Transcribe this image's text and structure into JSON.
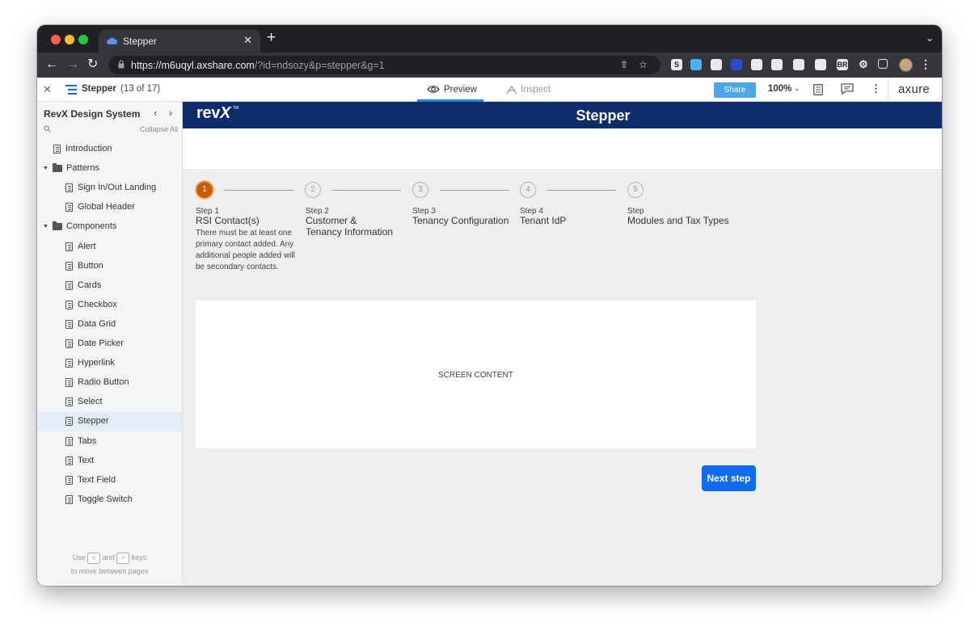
{
  "browser": {
    "tab_title": "Stepper",
    "tab_close": "✕",
    "new_tab": "+",
    "url_host": "https://m6uqyl.axshare.com",
    "url_path": "/?id=ndsozy&p=stepper&g=1",
    "extensions": [
      {
        "label": "S",
        "color": "#e8eaed"
      },
      {
        "label": "",
        "color": "#4db0ff"
      },
      {
        "label": "",
        "color": "#e8eaed"
      },
      {
        "label": "",
        "color": "#2b4bd1"
      },
      {
        "label": "",
        "color": "#e8eaed"
      },
      {
        "label": "",
        "color": "#e8eaed"
      },
      {
        "label": "",
        "color": "#e8eaed"
      },
      {
        "label": "",
        "color": "#e8eaed"
      },
      {
        "label": "BR",
        "color": "#e8eaed"
      }
    ]
  },
  "axure_toolbar": {
    "page_name": "Stepper",
    "page_count": "(13 of 17)",
    "preview_label": "Preview",
    "inspect_label": "Inspect",
    "share_label": "Share",
    "zoom": "100%",
    "logo": "axure"
  },
  "sidebar": {
    "title": "RevX Design System",
    "collapse_all": "Collapse All",
    "items": [
      {
        "label": "Introduction",
        "type": "page",
        "level": 0
      },
      {
        "label": "Patterns",
        "type": "folder",
        "level": 0
      },
      {
        "label": "Sign In/Out Landing",
        "type": "page",
        "level": 1
      },
      {
        "label": "Global Header",
        "type": "page",
        "level": 1
      },
      {
        "label": "Components",
        "type": "folder",
        "level": 0
      },
      {
        "label": "Alert",
        "type": "page",
        "level": 1
      },
      {
        "label": "Button",
        "type": "page",
        "level": 1
      },
      {
        "label": "Cards",
        "type": "page",
        "level": 1
      },
      {
        "label": "Checkbox",
        "type": "page",
        "level": 1
      },
      {
        "label": "Data Grid",
        "type": "page",
        "level": 1
      },
      {
        "label": "Date Picker",
        "type": "page",
        "level": 1
      },
      {
        "label": "Hyperlink",
        "type": "page",
        "level": 1
      },
      {
        "label": "Radio Button",
        "type": "page",
        "level": 1
      },
      {
        "label": "Select",
        "type": "page",
        "level": 1
      },
      {
        "label": "Stepper",
        "type": "page",
        "level": 1,
        "active": true
      },
      {
        "label": "Tabs",
        "type": "page",
        "level": 1
      },
      {
        "label": "Text",
        "type": "page",
        "level": 1
      },
      {
        "label": "Text Field",
        "type": "page",
        "level": 1
      },
      {
        "label": "Toggle Switch",
        "type": "page",
        "level": 1
      }
    ],
    "hint_use": "Use",
    "hint_and": "and",
    "hint_keys": "keys",
    "hint_line2": "to move between pages",
    "key_prev": "<",
    "key_next": ">"
  },
  "app": {
    "brand": "rev",
    "brand_x": "X",
    "brand_tm": "TM",
    "header_title": "Stepper",
    "brand_color": "#0d2c6c",
    "accent_color": "#c85c0a",
    "button_color": "#0f6cf0"
  },
  "stepper": {
    "steps": [
      {
        "number": "1",
        "step_label": "Step 1",
        "title": "RSI Contact(s)",
        "description": "There must be at least one primary contact added. Any additional people added will be secondary contacts.",
        "active": true
      },
      {
        "number": "2",
        "step_label": "Step 2",
        "title": "Customer &\nTenancy Information",
        "description": "",
        "active": false
      },
      {
        "number": "3",
        "step_label": "Step 3",
        "title": "Tenancy Configuration",
        "description": "",
        "active": false
      },
      {
        "number": "4",
        "step_label": "Step 4",
        "title": "Tenant IdP",
        "description": "",
        "active": false
      },
      {
        "number": "5",
        "step_label": "Step",
        "title": "Modules and Tax Types",
        "description": "",
        "active": false
      }
    ]
  },
  "content": {
    "label": "SCREEN CONTENT"
  },
  "actions": {
    "next_step": "Next step"
  }
}
